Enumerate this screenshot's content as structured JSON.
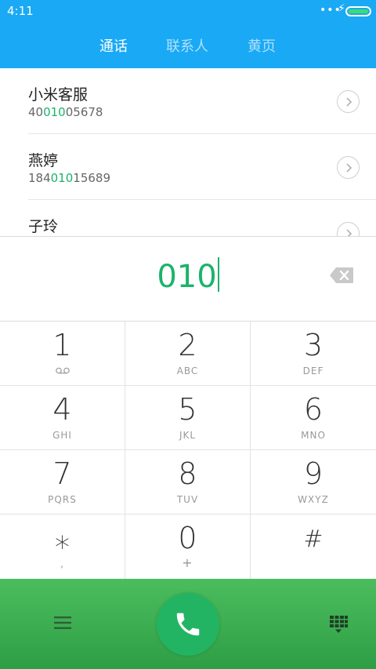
{
  "status_bar": {
    "time": "4:11",
    "dots": "•••"
  },
  "tabs": [
    {
      "label": "通话",
      "active": true
    },
    {
      "label": "联系人",
      "active": false
    },
    {
      "label": "黄页",
      "active": false
    }
  ],
  "contacts": [
    {
      "name": "小米客服",
      "number_pre": "40",
      "number_match": "010",
      "number_post": "05678"
    },
    {
      "name": "燕婷",
      "number_pre": "184",
      "number_match": "010",
      "number_post": "15689"
    },
    {
      "name": "子玲",
      "number_pre": "",
      "number_match": "",
      "number_post": ""
    }
  ],
  "dial_input": {
    "value": "010"
  },
  "keypad": [
    {
      "digit": "1",
      "letters": ""
    },
    {
      "digit": "2",
      "letters": "ABC"
    },
    {
      "digit": "3",
      "letters": "DEF"
    },
    {
      "digit": "4",
      "letters": "GHI"
    },
    {
      "digit": "5",
      "letters": "JKL"
    },
    {
      "digit": "6",
      "letters": "MNO"
    },
    {
      "digit": "7",
      "letters": "PQRS"
    },
    {
      "digit": "8",
      "letters": "TUV"
    },
    {
      "digit": "9",
      "letters": "WXYZ"
    },
    {
      "digit": "⁎",
      "letters": ","
    },
    {
      "digit": "0",
      "letters": "+"
    },
    {
      "digit": "#",
      "letters": ""
    }
  ],
  "icons": {
    "voicemail": "voicemail-icon",
    "backspace": "backspace-icon",
    "menu": "menu-icon",
    "call": "phone-icon",
    "keypad_toggle": "dialpad-icon",
    "chevron": "chevron-right-icon"
  },
  "colors": {
    "header": "#1aa9f5",
    "accent_green": "#1bb36a",
    "bottom_bar": "#3aab50",
    "call_button": "#23b463"
  }
}
